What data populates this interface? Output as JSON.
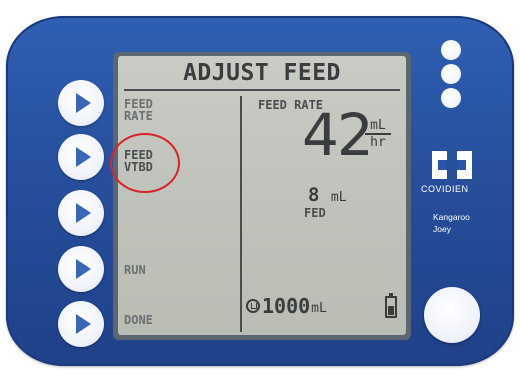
{
  "screen": {
    "title": "ADJUST FEED",
    "menu": [
      {
        "id": "feed-rate",
        "label": "FEED\nRATE"
      },
      {
        "id": "feed-vtbd",
        "label": "FEED\nVTBD"
      },
      {
        "id": "blank",
        "label": ""
      },
      {
        "id": "run",
        "label": "RUN"
      },
      {
        "id": "done",
        "label": "DONE"
      }
    ],
    "feed_rate": {
      "label": "FEED RATE",
      "value": "42",
      "unit_num": "mL",
      "unit_den": "hr"
    },
    "fed": {
      "value": "8",
      "unit": "mL",
      "label": "FED"
    },
    "volume": {
      "value": "1000",
      "unit": "mL"
    }
  },
  "device": {
    "brand": "COVIDIEN",
    "model": "Kangaroo\nJoey"
  },
  "icons": [
    "play-triangle-icon",
    "battery-icon",
    "volume-reservoir-icon",
    "covidien-logo-icon"
  ],
  "colors": {
    "casing": "#2a54a5",
    "lcd": "#c4c8bf",
    "highlight": "#d8232a"
  }
}
